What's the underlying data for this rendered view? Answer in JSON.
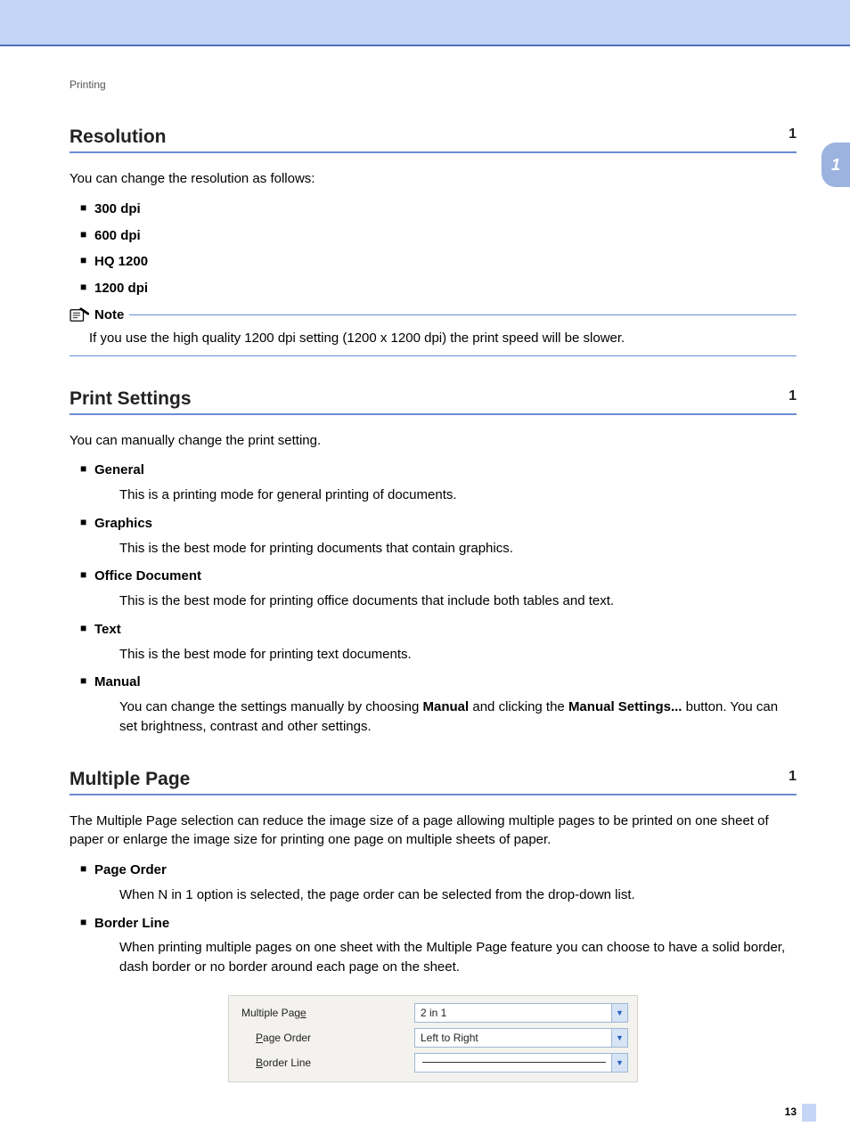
{
  "breadcrumb": "Printing",
  "chapterTab": "1",
  "pageNumber": "13",
  "resolution": {
    "title": "Resolution",
    "anchor": "1",
    "intro": "You can change the resolution as follows:",
    "items": [
      "300 dpi",
      "600 dpi",
      "HQ 1200",
      "1200 dpi"
    ],
    "noteLabel": "Note",
    "noteBody": "If you use the high quality 1200 dpi setting (1200 x 1200 dpi) the print speed will be slower."
  },
  "printSettings": {
    "title": "Print Settings",
    "anchor": "1",
    "intro": "You can manually change the print setting.",
    "items": [
      {
        "label": "General",
        "desc": "This is a printing mode for general printing of documents."
      },
      {
        "label": "Graphics",
        "desc": "This is the best mode for printing documents that contain graphics."
      },
      {
        "label": "Office Document",
        "desc": "This is the best mode for printing office documents that include both tables and text."
      },
      {
        "label": "Text",
        "desc": "This is the best mode for printing text documents."
      },
      {
        "label": "Manual",
        "desc_pre": "You can change the settings manually by choosing ",
        "desc_b1": "Manual",
        "desc_mid": " and clicking the ",
        "desc_b2": "Manual Settings...",
        "desc_post": " button. You can set brightness, contrast and other settings."
      }
    ]
  },
  "multiplePage": {
    "title": "Multiple Page",
    "anchor": "1",
    "intro": "The Multiple Page selection can reduce the image size of a page allowing multiple pages to be printed on one sheet of paper or enlarge the image size for printing one page on multiple sheets of paper.",
    "items": [
      {
        "label": "Page Order",
        "desc": "When N in 1 option is selected, the page order can be selected from the drop-down list."
      },
      {
        "label": "Border Line",
        "desc": "When printing multiple pages on one sheet with the Multiple Page feature you can choose to have a solid border, dash border or no border around each page on the sheet."
      }
    ]
  },
  "dialog": {
    "rows": [
      {
        "label_pre": "Multiple Pag",
        "accel": "e",
        "label_post": "",
        "indent": false,
        "value": "2 in 1",
        "line": false
      },
      {
        "label_pre": "",
        "accel": "P",
        "label_post": "age Order",
        "indent": true,
        "value": "Left to Right",
        "line": false
      },
      {
        "label_pre": "",
        "accel": "B",
        "label_post": "order Line",
        "indent": true,
        "value": "",
        "line": true
      }
    ]
  }
}
